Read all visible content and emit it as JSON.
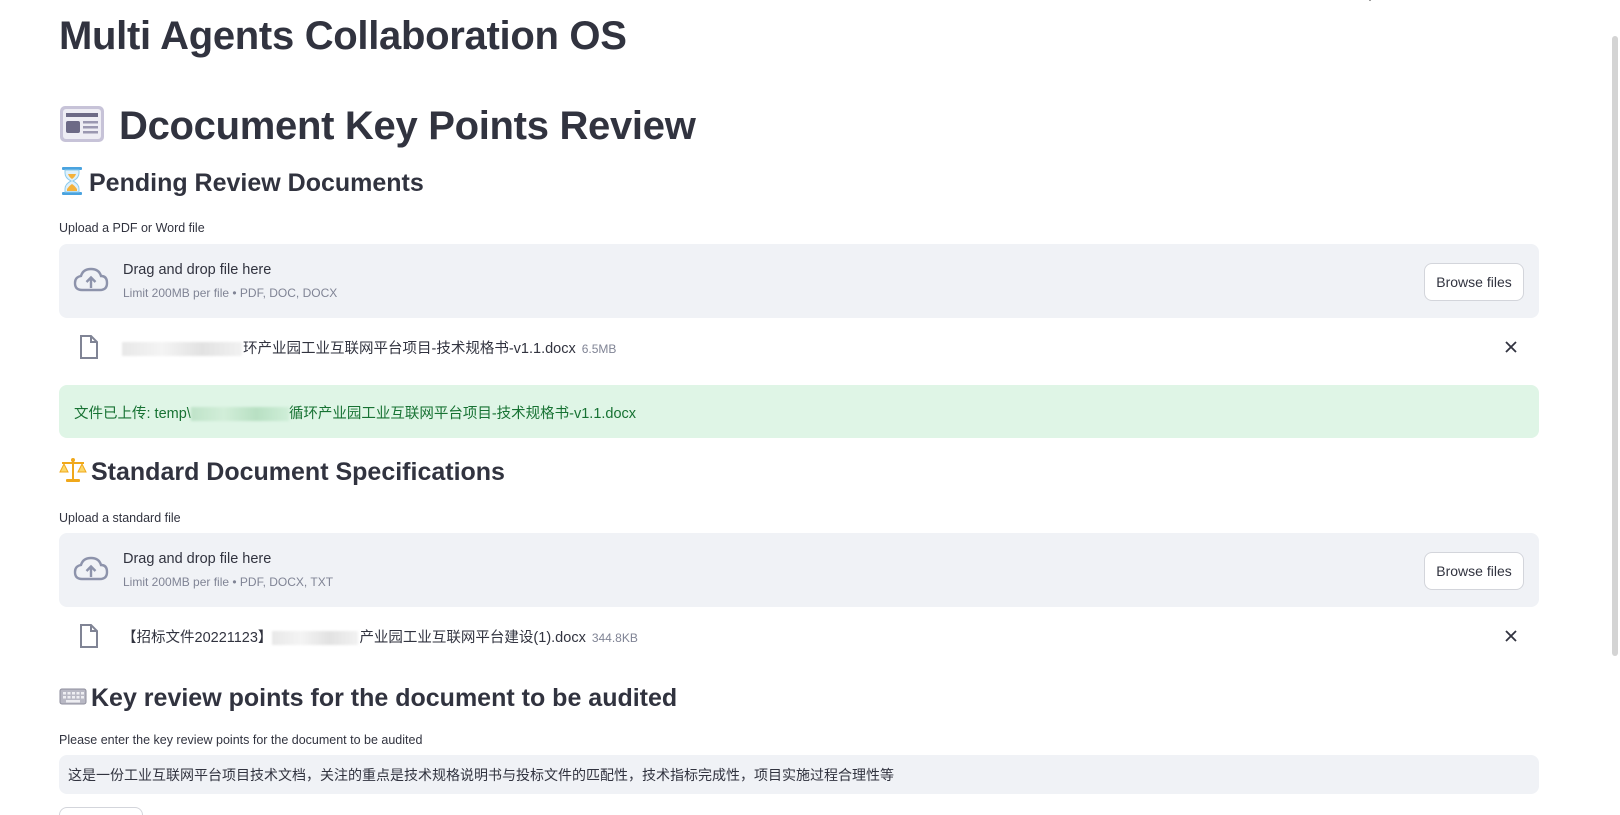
{
  "app": {
    "title": "Multi Agents Collaboration OS"
  },
  "page": {
    "title": "Dcocument Key Points Review",
    "icon": "newspaper-icon"
  },
  "pending": {
    "heading": "Pending Review Documents",
    "icon": "hourglass-icon",
    "upload_label": "Upload a PDF or Word file",
    "dropzone": {
      "main_text": "Drag and drop file here",
      "limit_text": "Limit 200MB per file • PDF, DOC, DOCX",
      "button_label": "Browse files"
    },
    "file": {
      "name": "环产业园工业互联网平台项目-技术规格书-v1.1.docx",
      "size": "6.5MB"
    },
    "success_message": {
      "prefix": "文件已上传: temp\\",
      "suffix": "循环产业园工业互联网平台项目-技术规格书-v1.1.docx"
    }
  },
  "standard": {
    "heading": "Standard Document Specifications",
    "icon": "scales-icon",
    "upload_label": "Upload a standard file",
    "dropzone": {
      "main_text": "Drag and drop file here",
      "limit_text": "Limit 200MB per file • PDF, DOCX, TXT",
      "button_label": "Browse files"
    },
    "file": {
      "prefix": "【招标文件20221123】",
      "name": "产业园工业互联网平台建设(1).docx",
      "size": "344.8KB"
    }
  },
  "review": {
    "heading": "Key review points for the document to be audited",
    "icon": "keyboard-icon",
    "input_label": "Please enter the key review points for the document to be audited",
    "input_value": "这是一份工业互联网平台项目技术文档，关注的重点是技术规格说明书与投标文件的匹配性，技术指标完成性，项目实施过程合理性等"
  },
  "colors": {
    "accent_success_bg": "#dff5e6",
    "accent_success_text": "#177233",
    "dropzone_bg": "#f0f2f6"
  }
}
